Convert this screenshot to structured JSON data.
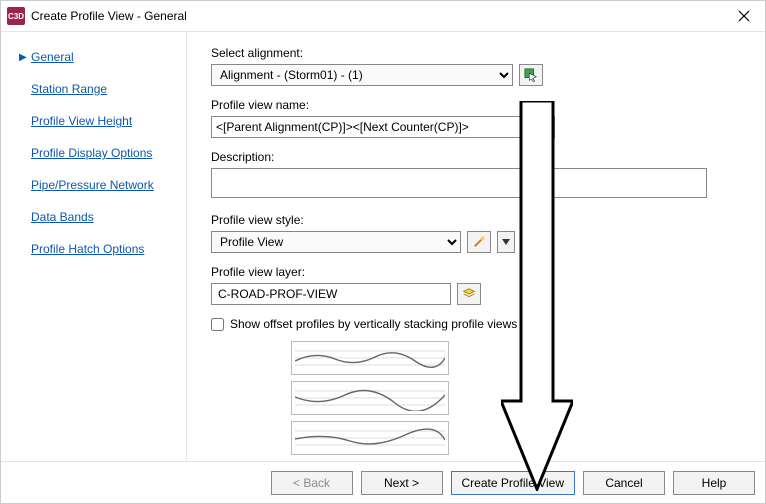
{
  "appicon_text": "C3D",
  "title": "Create Profile View - General",
  "sidebar": {
    "items": [
      {
        "label": "General",
        "active": true
      },
      {
        "label": "Station Range"
      },
      {
        "label": "Profile View Height"
      },
      {
        "label": "Profile Display Options"
      },
      {
        "label": "Pipe/Pressure Network"
      },
      {
        "label": "Data Bands"
      },
      {
        "label": "Profile Hatch Options"
      }
    ]
  },
  "content": {
    "select_alignment_label": "Select alignment:",
    "alignment_value": "Alignment - (Storm01) - (1)",
    "profile_view_name_label": "Profile view name:",
    "profile_view_name_value": "<[Parent Alignment(CP)]><[Next Counter(CP)]>",
    "description_label": "Description:",
    "description_value": "",
    "profile_view_style_label": "Profile view style:",
    "profile_view_style_value": "Profile View",
    "profile_view_layer_label": "Profile view layer:",
    "profile_view_layer_value": "C-ROAD-PROF-VIEW",
    "checkbox_label": "Show offset profiles by vertically stacking profile views"
  },
  "footer": {
    "back": "< Back",
    "next": "Next >",
    "create": "Create Profile View",
    "cancel": "Cancel",
    "help": "Help"
  },
  "icons": {
    "pick": "pick-from-drawing-icon",
    "nameTemplate": "name-template-icon",
    "styleEdit": "style-edit-icon",
    "styleDropdown": "style-dropdown-icon",
    "layerPick": "layer-pick-icon"
  }
}
